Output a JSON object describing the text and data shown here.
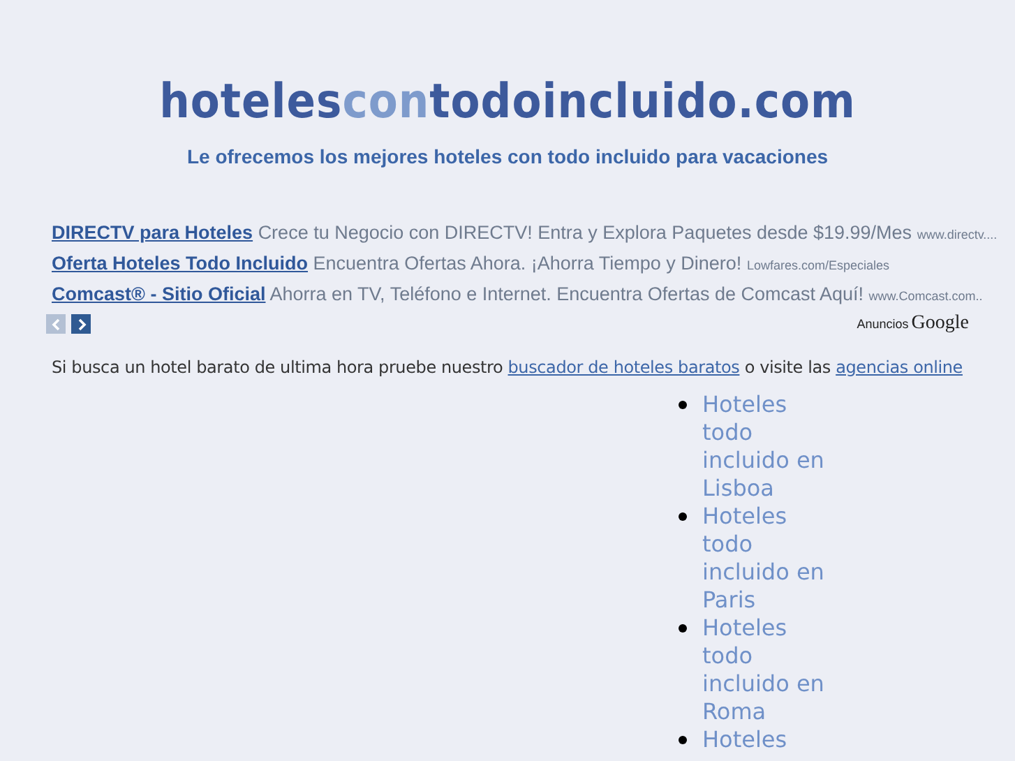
{
  "logo": [
    {
      "text": "hoteles",
      "kind": "dark"
    },
    {
      "text": "con",
      "kind": "light"
    },
    {
      "text": "todoincluido.com",
      "kind": "dark"
    }
  ],
  "tagline": "Le ofrecemos los mejores hoteles con todo incluido para vacaciones",
  "ads": [
    {
      "title": "DIRECTV para Hoteles",
      "text": "Crece tu Negocio con DIRECTV! Entra y Explora Paquetes desde $19.99/Mes",
      "url": "www.directv...."
    },
    {
      "title": "Oferta Hoteles Todo Incluido",
      "text": "Encuentra Ofertas Ahora. ¡Ahorra Tiempo y Dinero!",
      "url": "Lowfares.com/Especiales"
    },
    {
      "title": "Comcast® - Sitio Oficial",
      "text": "Ahorra en TV, Teléfono e Internet. Encuentra Ofertas de Comcast Aquí!",
      "url": "www.Comcast.com.."
    }
  ],
  "ad_nav": [
    {
      "kind": "prev",
      "disabled": true
    },
    {
      "kind": "next",
      "disabled": false
    }
  ],
  "ads_by": {
    "label": "Anuncios",
    "brand": "Google"
  },
  "intro": {
    "text": "Si busca un hotel barato de ultima hora pruebe nuestro",
    "link1": "buscador de hoteles baratos",
    "middle": "o visite las",
    "link2": "agencias online"
  },
  "links": [
    "Hoteles todo incluido en Lisboa",
    "Hoteles todo incluido en Paris",
    "Hoteles todo incluido en Roma",
    "Hoteles"
  ]
}
